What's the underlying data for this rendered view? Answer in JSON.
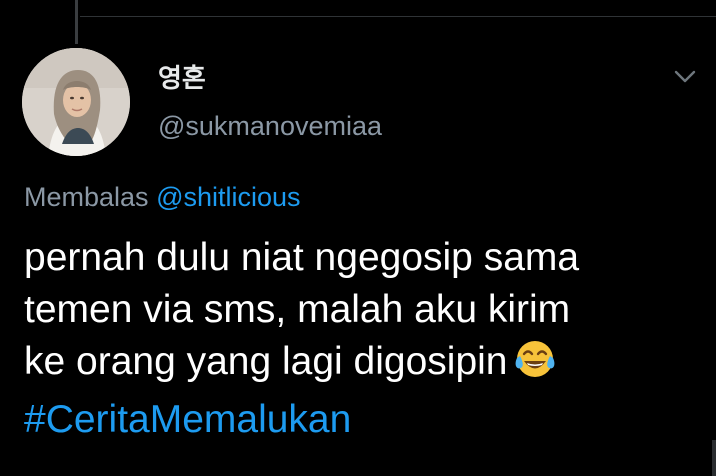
{
  "tweet": {
    "display_name": "영혼",
    "handle": "@sukmanovemiaa",
    "reply_prefix": "Membalas",
    "reply_to": "@shitlicious",
    "text_lines": [
      "pernah dulu niat ngegosip sama",
      "temen via sms, malah aku kirim",
      "ke orang yang lagi digosipin"
    ],
    "hashtag": "#CeritaMemalukan",
    "emoji_icon": "tears-of-joy-emoji"
  },
  "colors": {
    "background": "#000000",
    "text": "#ffffff",
    "secondary": "#8b98a5",
    "link": "#1d9bf0"
  }
}
